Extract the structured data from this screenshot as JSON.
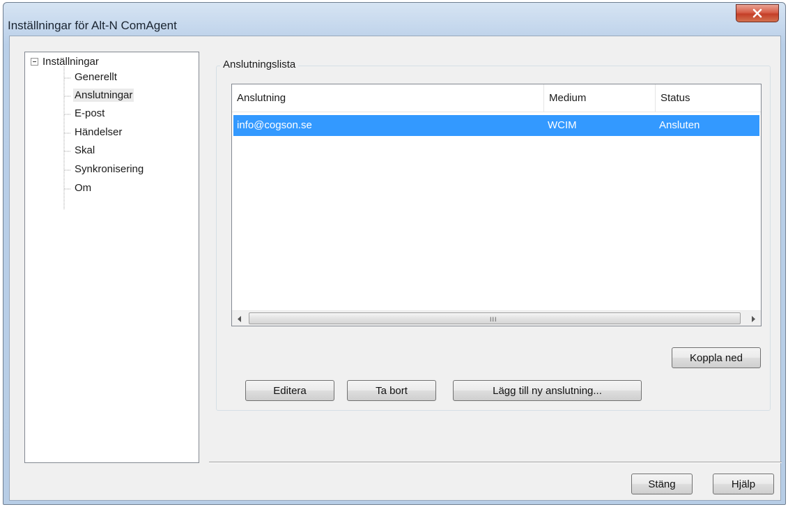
{
  "window": {
    "title": "Inställningar för Alt-N ComAgent",
    "close_icon": "close-x-icon"
  },
  "tree": {
    "root": "Inställningar",
    "items": [
      {
        "label": "Generellt",
        "selected": false
      },
      {
        "label": "Anslutningar",
        "selected": true
      },
      {
        "label": "E-post",
        "selected": false
      },
      {
        "label": "Händelser",
        "selected": false
      },
      {
        "label": "Skal",
        "selected": false
      },
      {
        "label": "Synkronisering",
        "selected": false
      },
      {
        "label": "Om",
        "selected": false
      }
    ]
  },
  "connections": {
    "group_title": "Anslutningslista",
    "columns": [
      "Anslutning",
      "Medium",
      "Status"
    ],
    "rows": [
      {
        "connection": "info@cogson.se",
        "medium": "WCIM",
        "status": "Ansluten",
        "selected": true
      }
    ],
    "scrollbar": {
      "thumb_grip": "III"
    }
  },
  "buttons": {
    "disconnect": "Koppla ned",
    "edit": "Editera",
    "remove": "Ta bort",
    "add": "Lägg till ny anslutning...",
    "close": "Stäng",
    "help": "Hjälp"
  },
  "colors": {
    "selection": "#3399ff",
    "close_button": "#c43f28"
  }
}
